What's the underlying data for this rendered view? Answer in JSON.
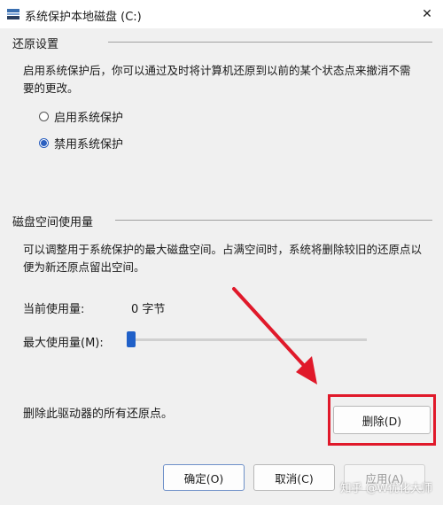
{
  "window": {
    "title": "系统保护本地磁盘 (C:)",
    "close_glyph": "✕"
  },
  "restore_settings": {
    "group_label": "还原设置",
    "description": "启用系统保护后，你可以通过及时将计算机还原到以前的某个状态点来撤消不需要的更改。",
    "options": [
      {
        "label": "启用系统保护",
        "selected": false
      },
      {
        "label": "禁用系统保护",
        "selected": true
      }
    ]
  },
  "disk_usage": {
    "group_label": "磁盘空间使用量",
    "description": "可以调整用于系统保护的最大磁盘空间。占满空间时，系统将删除较旧的还原点以便为新还原点留出空间。",
    "current_usage_label": "当前使用量:",
    "current_usage_value": "0 字节",
    "max_usage_label": "最大使用量(M):",
    "max_usage_slider_value": 0,
    "delete_text": "删除此驱动器的所有还原点。",
    "delete_button": "删除(D)"
  },
  "footer": {
    "ok_button": "确定(O)",
    "cancel_button": "取消(C)",
    "apply_button": "应用(A)"
  },
  "watermark": "知乎 @W优化大师",
  "colors": {
    "accent": "#2b5fbf",
    "annotation_red": "#e0192a"
  },
  "icons": {
    "app": "system-protection-icon",
    "close": "close-icon",
    "arrow": "red-arrow-annotation"
  }
}
